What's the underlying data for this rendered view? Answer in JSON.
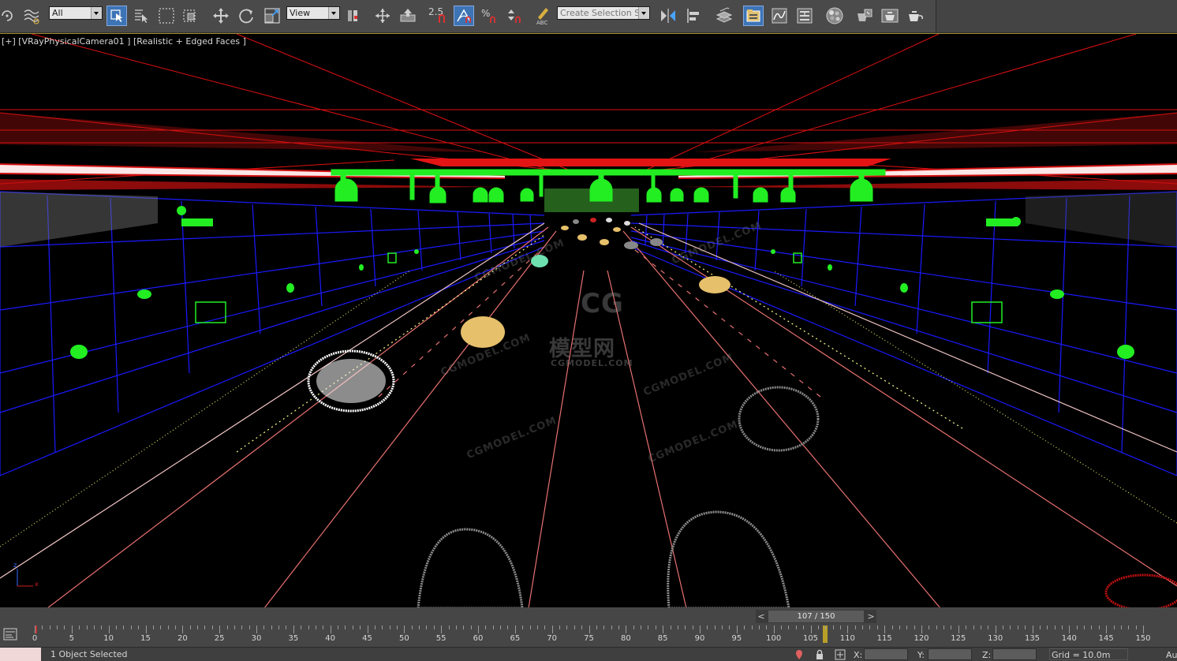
{
  "toolbar": {
    "selection_filter": "All",
    "reference_coord": "View",
    "angle_snap_label": "2.5",
    "named_selection_placeholder": "Create Selection Se",
    "tools": [
      "undo-icon",
      "bind-space-warp-icon",
      "select-object-icon",
      "select-by-name-icon",
      "rectangular-selection-region-icon",
      "window-crossing-icon",
      "select-and-move-icon",
      "select-and-rotate-icon",
      "select-and-scale-icon",
      "use-pivot-center-icon",
      "select-and-manipulate-icon",
      "keyboard-shortcut-override-icon",
      "snaps-toggle-icon",
      "angle-snap-toggle-icon",
      "percent-snap-toggle-icon",
      "spinner-snap-toggle-icon",
      "edit-named-selection-sets-icon",
      "mirror-icon",
      "align-icon",
      "layer-manager-icon",
      "scene-explorer-icon",
      "curve-editor-icon",
      "schematic-view-icon",
      "material-editor-icon",
      "render-setup-icon",
      "rendered-frame-window-icon",
      "render-production-icon"
    ],
    "active_color": "#3d74b6"
  },
  "viewport": {
    "label": "[+] [VRayPhysicalCamera01 ] [Realistic + Edged Faces ]",
    "watermark_logo": "CG",
    "watermark_cn": "模型网",
    "watermark_url": "CGMODEL.COM",
    "colors": {
      "tunnel_wall": "#1a1aff",
      "lighting_fixtures": "#22ee22",
      "ceiling": "#e01010",
      "background": "#000000"
    }
  },
  "timeline": {
    "frame_display": "107 / 150",
    "current_frame": 107,
    "total_frames": 150,
    "prev_label": "<",
    "next_label": ">",
    "tick_labels": [
      "0",
      "5",
      "10",
      "15",
      "20",
      "25",
      "30",
      "35",
      "40",
      "45",
      "50",
      "55",
      "60",
      "65",
      "70",
      "75",
      "80",
      "85",
      "90",
      "95",
      "100",
      "105",
      "110",
      "115",
      "120",
      "125",
      "130",
      "135",
      "140",
      "145",
      "150"
    ]
  },
  "statusbar": {
    "status_text": "1 Object Selected",
    "x_label": "X:",
    "y_label": "Y:",
    "z_label": "Z:",
    "grid_text": "Grid = 10.0m",
    "auto_key_label": "Au"
  }
}
